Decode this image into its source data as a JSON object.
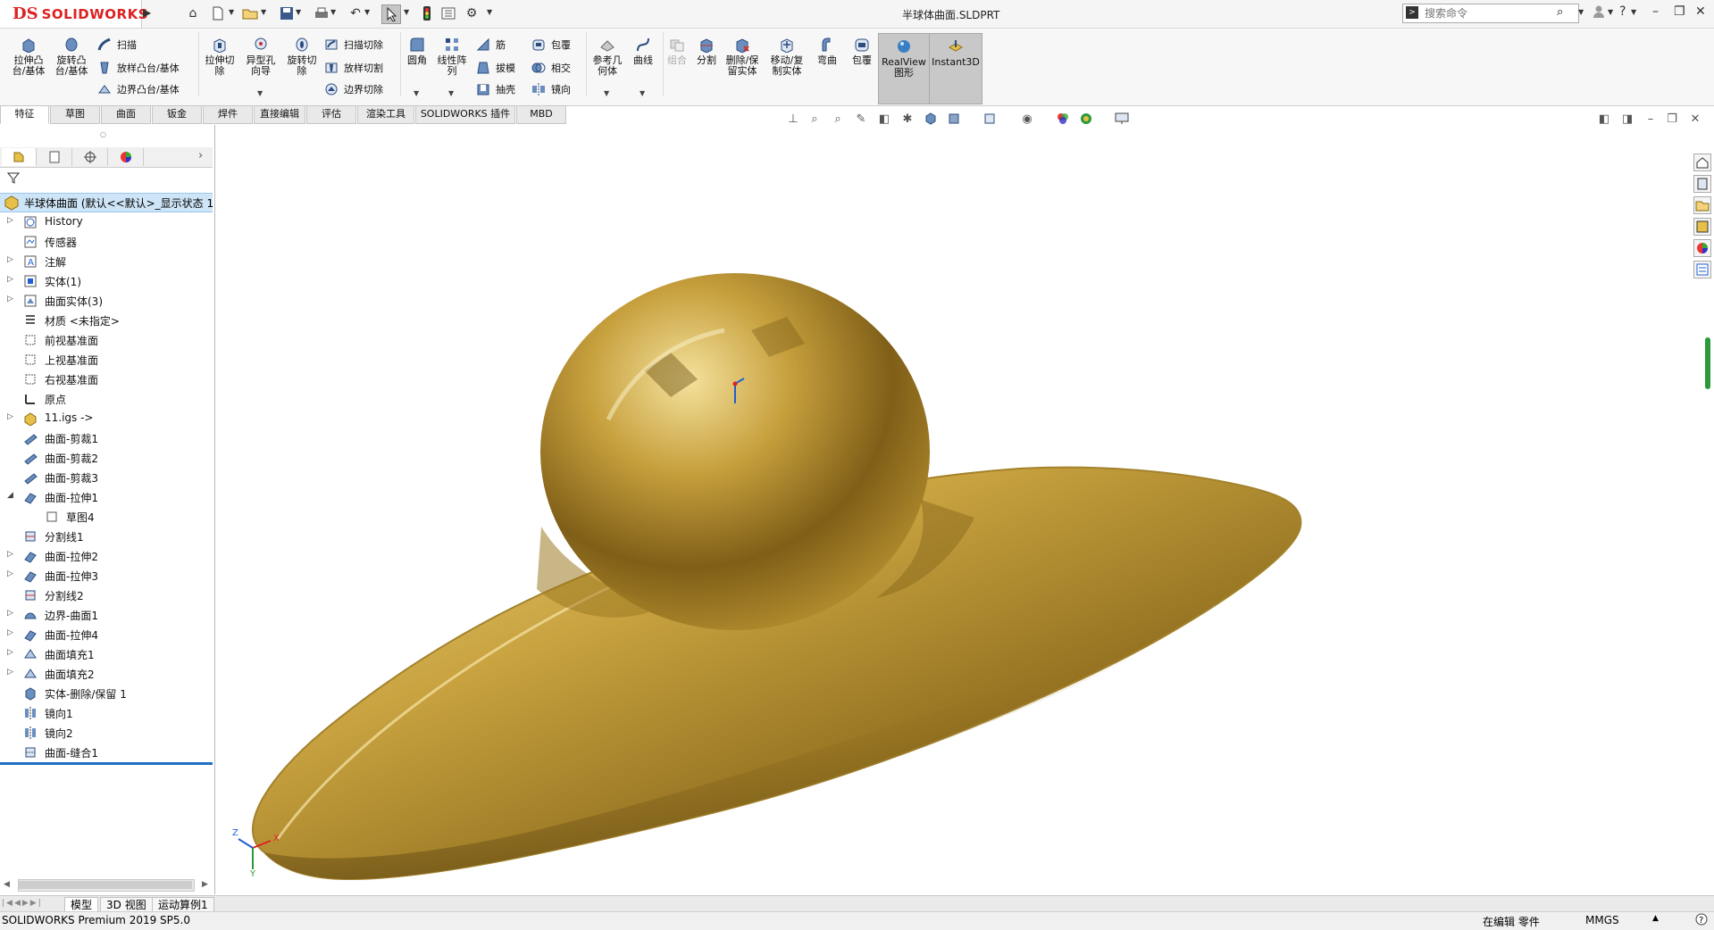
{
  "app": {
    "logo_ds": "DS",
    "logo_text": "SOLIDWORKS",
    "document_title": "半球体曲面.SLDPRT"
  },
  "search": {
    "placeholder": "搜索命令"
  },
  "command_manager": {
    "features": {
      "extrude_boss": "拉伸凸\n台/基体",
      "revolve_boss": "旋转凸\n台/基体",
      "sweep": "扫描",
      "loft_boss": "放样凸台/基体",
      "boundary_boss": "边界凸台/基体",
      "extrude_cut": "拉伸切\n除",
      "hole_wizard": "异型孔\n向导",
      "revolve_cut": "旋转切\n除",
      "swept_cut": "扫描切除",
      "lofted_cut": "放样切割",
      "boundary_cut": "边界切除",
      "fillet": "圆角",
      "linear_pattern": "线性阵\n列",
      "rib": "筋",
      "draft": "拔模",
      "shell": "抽壳",
      "wrap": "包覆",
      "intersect": "相交",
      "mirror": "镜向",
      "reference_geometry": "参考几\n何体",
      "curves": "曲线",
      "combine": "组合",
      "split": "分割",
      "delete_keep_body": "删除/保\n留实体",
      "move_copy_body": "移动/复\n制实体",
      "flex": "弯曲",
      "cover": "包覆",
      "realview": "RealView\n图形",
      "instant3d": "Instant3D"
    },
    "tabs": [
      "特征",
      "草图",
      "曲面",
      "钣金",
      "焊件",
      "直接编辑",
      "评估",
      "渲染工具",
      "SOLIDWORKS 插件",
      "MBD"
    ],
    "active_tab": "特征"
  },
  "feature_tree": {
    "root_label": "半球体曲面 (默认<<默认>_显示状态 1",
    "items": [
      {
        "label": "History",
        "expand": true,
        "icon": "history-icon"
      },
      {
        "label": "传感器",
        "expand": false,
        "icon": "sensor-icon"
      },
      {
        "label": "注解",
        "expand": true,
        "icon": "annotation-icon"
      },
      {
        "label": "实体(1)",
        "expand": true,
        "icon": "solid-bodies-icon"
      },
      {
        "label": "曲面实体(3)",
        "expand": true,
        "icon": "surface-bodies-icon"
      },
      {
        "label": "材质 <未指定>",
        "expand": false,
        "icon": "material-icon"
      },
      {
        "label": "前视基准面",
        "expand": false,
        "icon": "plane-icon"
      },
      {
        "label": "上视基准面",
        "expand": false,
        "icon": "plane-icon"
      },
      {
        "label": "右视基准面",
        "expand": false,
        "icon": "plane-icon"
      },
      {
        "label": "原点",
        "expand": false,
        "icon": "origin-icon"
      },
      {
        "label": "11.igs ->",
        "expand": true,
        "icon": "imported-part-icon"
      },
      {
        "label": "曲面-剪裁1",
        "expand": false,
        "icon": "surface-trim-icon"
      },
      {
        "label": "曲面-剪裁2",
        "expand": false,
        "icon": "surface-trim-icon"
      },
      {
        "label": "曲面-剪裁3",
        "expand": false,
        "icon": "surface-trim-icon"
      },
      {
        "label": "曲面-拉伸1",
        "expand": true,
        "expanded": true,
        "icon": "surface-extrude-icon"
      },
      {
        "label": "草图4",
        "expand": false,
        "child": true,
        "icon": "sketch-icon"
      },
      {
        "label": "分割线1",
        "expand": false,
        "icon": "split-line-icon"
      },
      {
        "label": "曲面-拉伸2",
        "expand": true,
        "icon": "surface-extrude-icon"
      },
      {
        "label": "曲面-拉伸3",
        "expand": true,
        "icon": "surface-extrude-icon"
      },
      {
        "label": "分割线2",
        "expand": false,
        "icon": "split-line-icon"
      },
      {
        "label": "边界-曲面1",
        "expand": true,
        "icon": "boundary-surface-icon"
      },
      {
        "label": "曲面-拉伸4",
        "expand": true,
        "icon": "surface-extrude-icon"
      },
      {
        "label": "曲面填充1",
        "expand": true,
        "icon": "surface-fill-icon"
      },
      {
        "label": "曲面填充2",
        "expand": true,
        "icon": "surface-fill-icon"
      },
      {
        "label": "实体-删除/保留 1",
        "expand": false,
        "icon": "delete-body-icon"
      },
      {
        "label": "镜向1",
        "expand": false,
        "icon": "mirror-icon"
      },
      {
        "label": "镜向2",
        "expand": false,
        "icon": "mirror-icon"
      },
      {
        "label": "曲面-缝合1",
        "expand": false,
        "icon": "surface-knit-icon"
      }
    ]
  },
  "triad": {
    "x": "X",
    "y": "Y",
    "z": "Z"
  },
  "bottom_tabs": [
    "模型",
    "3D 视图",
    "运动算例1"
  ],
  "status": {
    "version": "SOLIDWORKS Premium 2019 SP5.0",
    "editing": "在编辑 零件",
    "units": "MMGS"
  },
  "colors": {
    "brand": "#d22222",
    "tree_selection": "#cde5f7",
    "rollback_bar": "#1f6fc2",
    "model_gold": "#c9a63c"
  }
}
